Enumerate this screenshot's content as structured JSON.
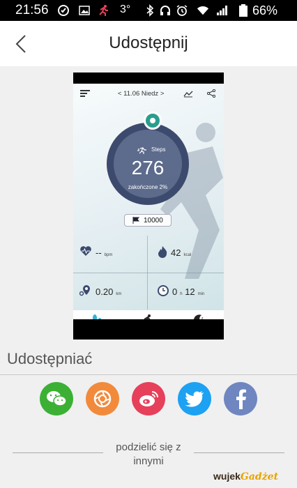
{
  "status_bar": {
    "time": "21:56",
    "temperature": "3°",
    "battery": "66%",
    "icons": [
      "sync-icon",
      "image-icon",
      "runner-icon",
      "bluetooth-icon",
      "headset-icon",
      "alarm-icon",
      "wifi-icon",
      "signal-icon",
      "battery-icon"
    ]
  },
  "header": {
    "title": "Udostępnij",
    "back_icon": "chevron-left-icon"
  },
  "preview": {
    "date": "< 11.06  Niedz  >",
    "steps_label": "Steps",
    "steps_value": "276",
    "progress_text": "zakończone 2%",
    "goal": "10000",
    "heart_value": "--",
    "heart_unit": "bpm",
    "kcal_value": "42",
    "kcal_unit": "kcal",
    "distance_value": "0.20",
    "distance_unit": "km",
    "time_hours": "0",
    "time_h_unit": "h",
    "time_minutes": "12",
    "time_min_unit": "min",
    "progress_fraction": 0.02
  },
  "share": {
    "heading": "Udostępniać",
    "services": [
      {
        "name": "wechat",
        "color": "#3cb034"
      },
      {
        "name": "moments",
        "color": "#f28a3c"
      },
      {
        "name": "weibo",
        "color": "#e6405a"
      },
      {
        "name": "twitter",
        "color": "#1da1f2"
      },
      {
        "name": "facebook",
        "color": "#6f86c0"
      }
    ],
    "footer_text": "podzielić się z innymi"
  },
  "watermark": {
    "part1": "wujek",
    "part2": "Gadżet"
  }
}
